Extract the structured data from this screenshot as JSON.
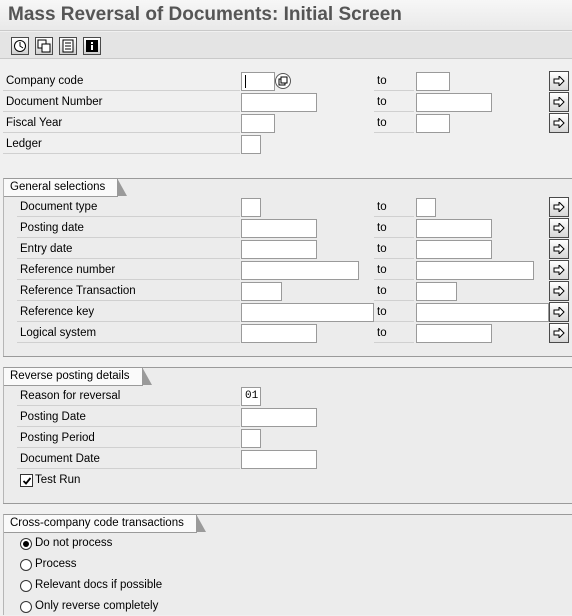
{
  "title": "Mass Reversal of Documents: Initial Screen",
  "toolbar": {
    "buttons": [
      "execute-icon",
      "get-variant-icon",
      "multiple-selection-icon",
      "program-info-icon"
    ]
  },
  "to_label": "to",
  "top_fields": [
    {
      "label": "Company code"
    },
    {
      "label": "Document Number"
    },
    {
      "label": "Fiscal Year"
    },
    {
      "label": "Ledger"
    }
  ],
  "general_selections": {
    "title": "General selections",
    "fields": [
      {
        "label": "Document type"
      },
      {
        "label": "Posting date"
      },
      {
        "label": "Entry date"
      },
      {
        "label": "Reference number"
      },
      {
        "label": "Reference Transaction"
      },
      {
        "label": "Reference key"
      },
      {
        "label": "Logical system"
      }
    ]
  },
  "reverse_posting": {
    "title": "Reverse posting details",
    "reason_label": "Reason for reversal",
    "reason_value": "01",
    "posting_date_label": "Posting Date",
    "posting_period_label": "Posting Period",
    "document_date_label": "Document Date",
    "test_run_label": "Test Run",
    "test_run_checked": true
  },
  "cross_company": {
    "title": "Cross-company code transactions",
    "options": [
      "Do not process",
      "Process",
      "Relevant docs if possible",
      "Only reverse completely"
    ],
    "selected": "Do not process"
  }
}
